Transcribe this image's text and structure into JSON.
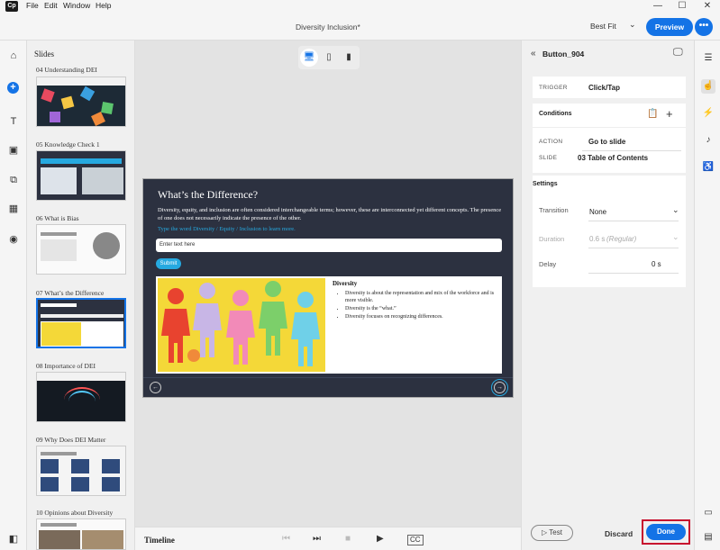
{
  "app": {
    "logo": "Cp",
    "title": "Diversity Inclusion*"
  },
  "menu": [
    "File",
    "Edit",
    "Window",
    "Help"
  ],
  "window_controls": {
    "minimize": "—",
    "maximize": "☐",
    "close": "✕"
  },
  "toolbar": {
    "zoom": "Best Fit",
    "preview_label": "Preview",
    "more_label": "•••"
  },
  "slides_panel": {
    "title": "Slides",
    "slides": [
      {
        "label": "04  Understanding DEI"
      },
      {
        "label": "05  Knowledge Check 1"
      },
      {
        "label": "06  What is Bias"
      },
      {
        "label": "07  What’s the Difference",
        "selected": true
      },
      {
        "label": "08  Importance of DEI"
      },
      {
        "label": "09  Why Does DEI Matter"
      },
      {
        "label": "10  Opinions about Diversity"
      }
    ]
  },
  "slide": {
    "heading": "What’s the Difference?",
    "body": "Diversity, equity, and inclusion are often considered interchangeable terms; however, these are interconnected yet different concepts. The presence of one does not necessarily indicate the presence of the other.",
    "hint": "Type the word Diversity / Equity / Inclusion to learn more.",
    "input_placeholder": "Enter text here",
    "submit_label": "Submit",
    "card_heading": "Diversity",
    "card_items": [
      "Diversity is about the representation and mix of the workforce and is more visible.",
      "Diversity is the “what.”",
      "Diversity focuses on recognizing differences."
    ]
  },
  "timeline": {
    "label": "Timeline"
  },
  "props": {
    "title": "Button_904",
    "trigger_label": "TRIGGER",
    "trigger_value": "Click/Tap",
    "conditions_label": "Conditions",
    "action_label": "ACTION",
    "action_value": "Go to slide",
    "slide_label": "SLIDE",
    "slide_value": "03 Table of Contents",
    "settings_label": "Settings",
    "transition_label": "Transition",
    "transition_value": "None",
    "duration_label": "Duration",
    "duration_value": "0.6 s",
    "duration_regular": "(Regular)",
    "delay_label": "Delay",
    "delay_value": "0 s",
    "test_label": "Test",
    "discard_label": "Discard",
    "done_label": "Done"
  },
  "colors": {
    "accent": "#1473e6",
    "slide_bg": "#2c3140",
    "link_cyan": "#26a9e0",
    "highlight_red": "#c8102e"
  }
}
